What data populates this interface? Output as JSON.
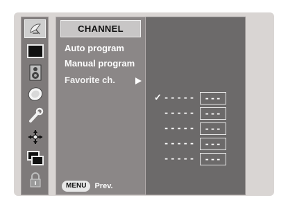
{
  "icons": [
    {
      "name": "satellite-dish-icon",
      "active": true
    },
    {
      "name": "picture-icon",
      "active": false
    },
    {
      "name": "speaker-icon",
      "active": false
    },
    {
      "name": "clock-icon",
      "active": false
    },
    {
      "name": "wrench-icon",
      "active": false
    },
    {
      "name": "special-icon",
      "active": false
    },
    {
      "name": "screen-icon",
      "active": false
    },
    {
      "name": "lock-icon",
      "active": false
    }
  ],
  "menu": {
    "title": "CHANNEL",
    "items": [
      {
        "label": "Auto program",
        "selected": false
      },
      {
        "label": "Manual program",
        "selected": false
      },
      {
        "label": "Favorite ch.",
        "selected": true
      }
    ],
    "footer": {
      "key": "MENU",
      "label": "Prev."
    }
  },
  "favorites": {
    "rows": [
      {
        "checked": true,
        "name": "-----",
        "channel": "---"
      },
      {
        "checked": false,
        "name": "-----",
        "channel": "---"
      },
      {
        "checked": false,
        "name": "-----",
        "channel": "---"
      },
      {
        "checked": false,
        "name": "-----",
        "channel": "---"
      },
      {
        "checked": false,
        "name": "-----",
        "channel": "---"
      }
    ],
    "check_glyph": "✓"
  }
}
